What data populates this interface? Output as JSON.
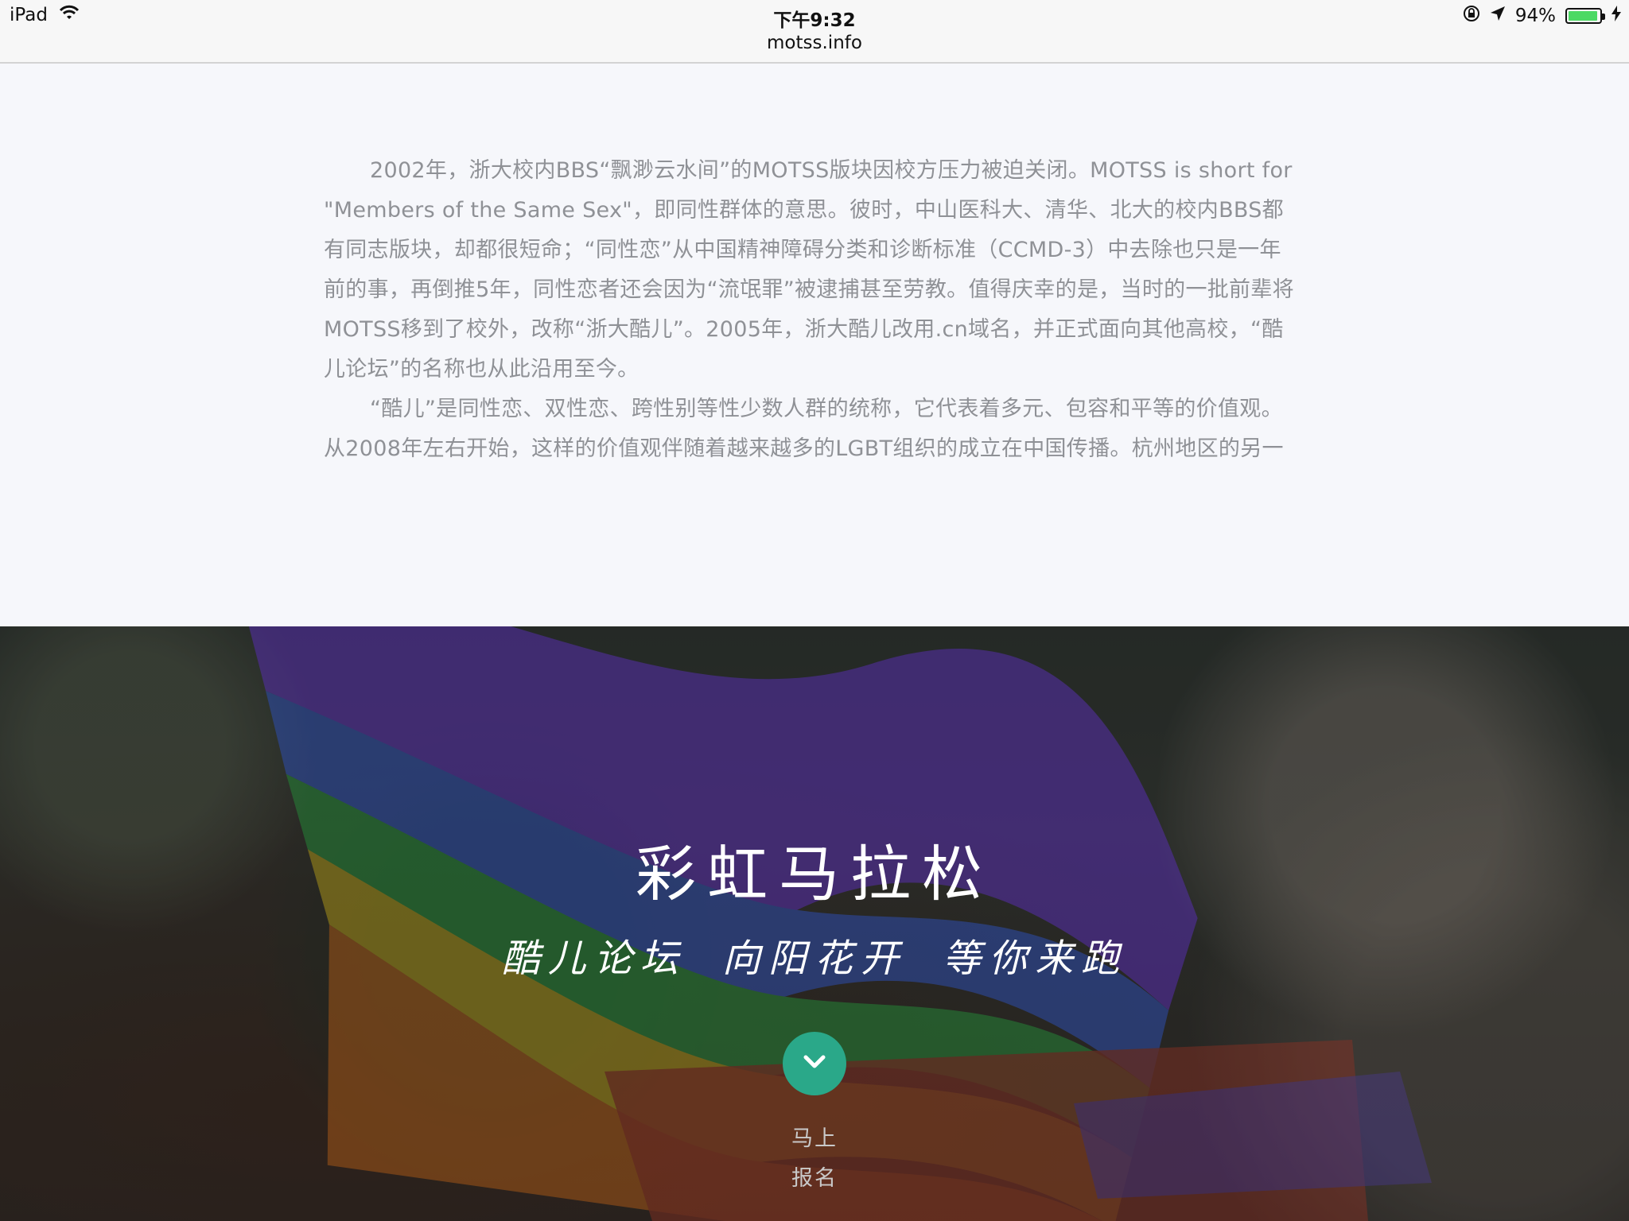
{
  "status_bar": {
    "device": "iPad",
    "time": "下午9:32",
    "url": "motss.info",
    "battery_percent_label": "94%",
    "battery_level": 0.94,
    "icons": [
      "wifi-icon",
      "rotation-lock-icon",
      "location-arrow-icon",
      "battery-icon",
      "charging-bolt-icon"
    ]
  },
  "article": {
    "paragraphs": [
      "2002年，浙大校内BBS“飘渺云水间”的MOTSS版块因校方压力被迫关闭。MOTSS is short for \"Members of the Same Sex\"，即同性群体的意思。彼时，中山医科大、清华、北大的校内BBS都有同志版块，却都很短命；“同性恋”从中国精神障碍分类和诊断标准（CCMD-3）中去除也只是一年前的事，再倒推5年，同性恋者还会因为“流氓罪”被逮捕甚至劳教。值得庆幸的是，当时的一批前辈将MOTSS移到了校外，改称“浙大酷儿”。2005年，浙大酷儿改用.cn域名，并正式面向其他高校，“酷儿论坛”的名称也从此沿用至今。",
      "“酷儿”是同性恋、双性恋、跨性别等性少数人群的统称，它代表着多元、包容和平等的价值观。从2008年左右开始，这样的价值观伴随着越来越多的LGBT组织的成立在中国传播。杭州地区的另一"
    ]
  },
  "hero": {
    "title": "彩虹马拉松",
    "subtitle": "酷儿论坛 向阳花开 等你来跑",
    "cta_line1": "马上",
    "cta_line2": "报名",
    "button_icon": "chevron-down-icon",
    "colors": {
      "button": "#2aa889",
      "title": "#ffffff",
      "cta": "#c9c9c9"
    }
  }
}
